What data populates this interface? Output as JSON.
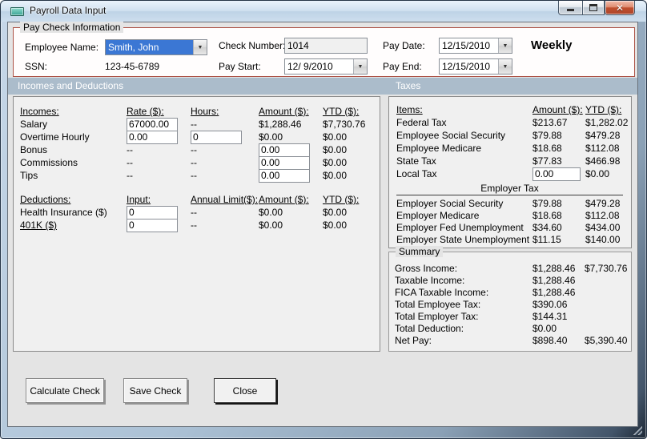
{
  "window": {
    "title": "Payroll Data Input",
    "close_glyph": "✕"
  },
  "icons": {
    "dropdown": "▼"
  },
  "paycheck": {
    "group_label": "Pay Check Information",
    "employee_name": {
      "label": "Employee Name:",
      "value": "Smith, John"
    },
    "ssn": {
      "label": "SSN:",
      "value": "123-45-6789"
    },
    "check_number": {
      "label": "Check Number:",
      "value": "1014"
    },
    "pay_start": {
      "label": "Pay Start:",
      "value": "12/ 9/2010"
    },
    "pay_date": {
      "label": "Pay Date:",
      "value": "12/15/2010"
    },
    "pay_end": {
      "label": "Pay End:",
      "value": "12/15/2010"
    },
    "frequency": "Weekly"
  },
  "section_headers": {
    "left": "Incomes and Deductions",
    "right": "Taxes"
  },
  "incomes": {
    "headers": {
      "item": "Incomes:",
      "rate": "Rate ($):",
      "hours": "Hours:",
      "amount": "Amount ($):",
      "ytd": "YTD ($):"
    },
    "rows": [
      {
        "label": "Salary",
        "rate": "67000.00",
        "hours": "--",
        "amount": "$1,288.46",
        "ytd": "$7,730.76"
      },
      {
        "label": "Overtime Hourly",
        "rate": "0.00",
        "hours": "0",
        "amount": "$0.00",
        "ytd": "$0.00"
      },
      {
        "label": "Bonus",
        "rate": "--",
        "hours": "--",
        "amount": "0.00",
        "ytd": "$0.00"
      },
      {
        "label": "Commissions",
        "rate": "--",
        "hours": "--",
        "amount": "0.00",
        "ytd": "$0.00"
      },
      {
        "label": "Tips",
        "rate": "--",
        "hours": "--",
        "amount": "0.00",
        "ytd": "$0.00"
      }
    ]
  },
  "deductions": {
    "headers": {
      "item": "Deductions:",
      "input": "Input:",
      "limit": "Annual Limit($):",
      "amount": "Amount ($):",
      "ytd": "YTD ($):"
    },
    "rows": [
      {
        "label": "Health Insurance  ($)",
        "input": "0",
        "limit": "--",
        "amount": "$0.00",
        "ytd": "$0.00"
      },
      {
        "label": "401K  ($)",
        "input": "0",
        "limit": "--",
        "amount": "$0.00",
        "ytd": "$0.00"
      }
    ]
  },
  "taxes": {
    "headers": {
      "item": "Items:",
      "amount": "Amount ($):",
      "ytd": "YTD ($):"
    },
    "employee_rows": [
      {
        "label": "Federal Tax",
        "amount": "$213.67",
        "ytd": "$1,282.02"
      },
      {
        "label": "Employee Social Security",
        "amount": "$79.88",
        "ytd": "$479.28"
      },
      {
        "label": "Employee Medicare",
        "amount": "$18.68",
        "ytd": "$112.08"
      },
      {
        "label": "State Tax",
        "amount": "$77.83",
        "ytd": "$466.98"
      },
      {
        "label": "Local Tax",
        "amount": "0.00",
        "ytd": "$0.00"
      }
    ],
    "employer_header": "Employer Tax",
    "employer_rows": [
      {
        "label": "Employer Social Security",
        "amount": "$79.88",
        "ytd": "$479.28"
      },
      {
        "label": "Employer Medicare",
        "amount": "$18.68",
        "ytd": "$112.08"
      },
      {
        "label": "Employer Fed Unemployment",
        "amount": "$34.60",
        "ytd": "$434.00"
      },
      {
        "label": "Employer State Unemployment",
        "amount": "$11.15",
        "ytd": "$140.00"
      }
    ]
  },
  "summary": {
    "group_label": "Summary",
    "rows": [
      {
        "label": "Gross Income:",
        "amount": "$1,288.46",
        "ytd": "$7,730.76"
      },
      {
        "label": "Taxable Income:",
        "amount": "$1,288.46",
        "ytd": ""
      },
      {
        "label": "FICA Taxable Income:",
        "amount": "$1,288.46",
        "ytd": ""
      },
      {
        "label": "Total Employee Tax:",
        "amount": "$390.06",
        "ytd": ""
      },
      {
        "label": "Total Employer Tax:",
        "amount": "$144.31",
        "ytd": ""
      },
      {
        "label": "Total Deduction:",
        "amount": "$0.00",
        "ytd": ""
      },
      {
        "label": "Net Pay:",
        "amount": "$898.40",
        "ytd": "$5,390.40"
      }
    ]
  },
  "buttons": {
    "calculate": "Calculate Check",
    "save": "Save Check",
    "close": "Close"
  }
}
